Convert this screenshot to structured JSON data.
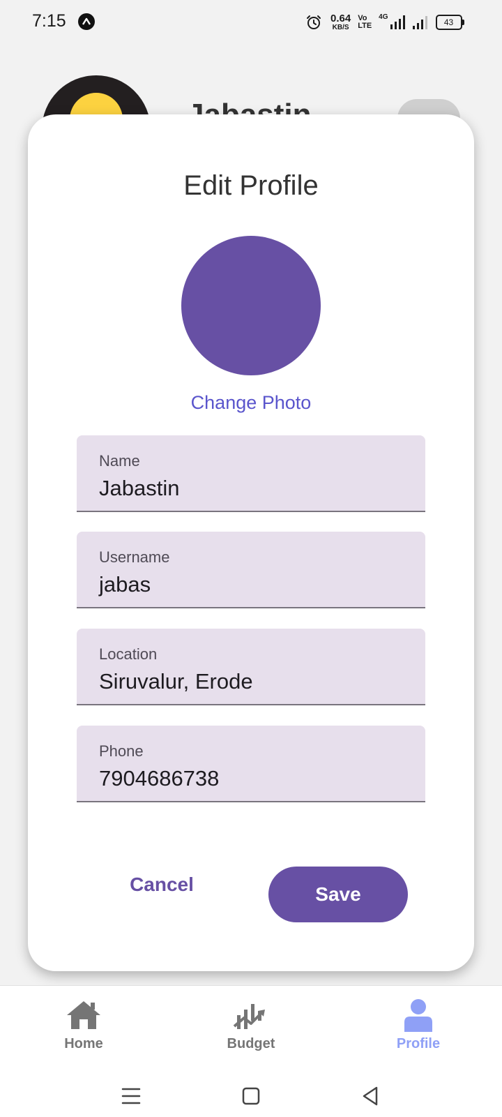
{
  "status_bar": {
    "time": "7:15",
    "net_speed_value": "0.64",
    "net_speed_unit": "KB/S",
    "volte_top": "Vo",
    "volte_bottom": "LTE",
    "network_type": "4G",
    "battery": "43"
  },
  "background": {
    "profile_name": "Jabastin"
  },
  "dialog": {
    "title": "Edit Profile",
    "change_photo_label": "Change Photo",
    "photo_color": "#6750a4",
    "fields": [
      {
        "label": "Name",
        "value": "Jabastin"
      },
      {
        "label": "Username",
        "value": "jabas"
      },
      {
        "label": "Location",
        "value": "Siruvalur, Erode"
      },
      {
        "label": "Phone",
        "value": "7904686738"
      }
    ],
    "cancel_label": "Cancel",
    "save_label": "Save"
  },
  "bottom_nav": {
    "items": [
      {
        "label": "Home",
        "icon": "home-icon",
        "active": false
      },
      {
        "label": "Budget",
        "icon": "chart-icon",
        "active": false
      },
      {
        "label": "Profile",
        "icon": "person-icon",
        "active": true
      }
    ]
  },
  "colors": {
    "accent": "#6750a4",
    "link": "#5a55cc",
    "field_bg": "#e7dfec",
    "nav_active": "#8fa0f6",
    "nav_inactive": "#757575"
  }
}
